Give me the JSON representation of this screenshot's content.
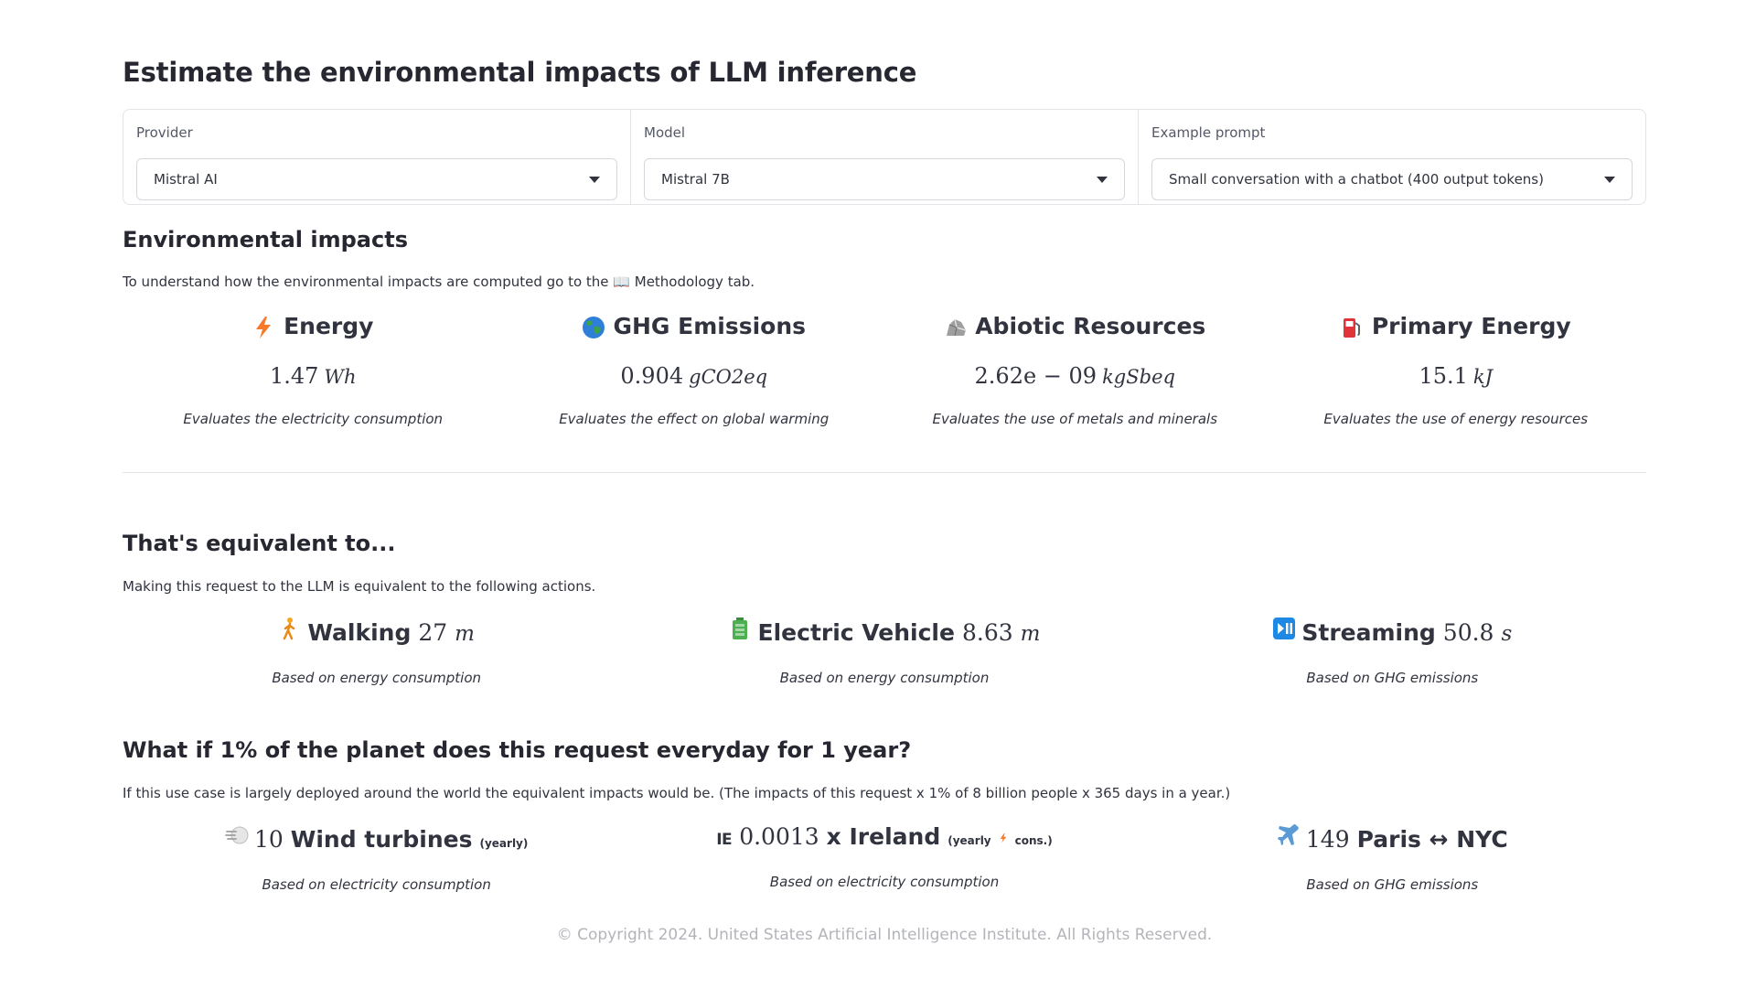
{
  "title": "Estimate the environmental impacts of LLM inference",
  "selectors": [
    {
      "label": "Provider",
      "value": "Mistral AI"
    },
    {
      "label": "Model",
      "value": "Mistral 7B"
    },
    {
      "label": "Example prompt",
      "value": "Small conversation with a chatbot (400 output tokens)"
    }
  ],
  "impacts": {
    "heading": "Environmental impacts",
    "desc": "To understand how the environmental impacts are computed go to the 📖 Methodology tab.",
    "metrics": [
      {
        "icon": "lightning-icon",
        "title": "Energy",
        "value": "1.47",
        "unit": "Wh",
        "caption": "Evaluates the electricity consumption"
      },
      {
        "icon": "globe-icon",
        "title": "GHG Emissions",
        "value": "0.904",
        "unit": "gCO2eq",
        "caption": "Evaluates the effect on global warming"
      },
      {
        "icon": "rock-icon",
        "title": "Abiotic Resources",
        "value": "2.62e − 09",
        "unit": "kgSbeq",
        "caption": "Evaluates the use of metals and minerals"
      },
      {
        "icon": "fuel-pump-icon",
        "title": "Primary Energy",
        "value": "15.1",
        "unit": "kJ",
        "caption": "Evaluates the use of energy resources"
      }
    ]
  },
  "equivalent": {
    "heading": "That's equivalent to...",
    "desc": "Making this request to the LLM is equivalent to the following actions.",
    "items": [
      {
        "icon": "walking-person-icon",
        "label": "Walking",
        "value": "27",
        "unit": "m",
        "caption": "Based on energy consumption"
      },
      {
        "icon": "battery-icon",
        "label": "Electric Vehicle",
        "value": "8.63",
        "unit": "m",
        "caption": "Based on energy consumption"
      },
      {
        "icon": "play-pause-icon",
        "label": "Streaming",
        "value": "50.8",
        "unit": "s",
        "caption": "Based on GHG emissions"
      }
    ]
  },
  "planet": {
    "heading": "What if 1% of the planet does this request everyday for 1 year?",
    "desc": "If this use case is largely deployed around the world the equivalent impacts would be. (The impacts of this request x 1% of 8 billion people x 365 days in a year.)",
    "items": [
      {
        "icon": "wind-icon",
        "value": "10",
        "label": "Wind turbines",
        "small": "(yearly)",
        "small2": "",
        "caption": "Based on electricity consumption"
      },
      {
        "icon": "ireland-flag-icon",
        "flag_text": "IE",
        "value": "0.0013",
        "label": "x Ireland",
        "small": "(yearly",
        "small2": "cons.)",
        "caption": "Based on electricity consumption"
      },
      {
        "icon": "airplane-icon",
        "value": "149",
        "label": "Paris ↔ NYC",
        "small": "",
        "small2": "",
        "caption": "Based on GHG emissions"
      }
    ]
  },
  "footer": "© Copyright 2024. United States Artificial Intelligence Institute. All Rights Reserved.",
  "colors": {
    "lightning": "#f7792a",
    "globe_blue": "#2f7fd8",
    "globe_green": "#3aa24a",
    "fuel": "#e0343a",
    "battery": "#4caf50",
    "play": "#1e88e5"
  }
}
